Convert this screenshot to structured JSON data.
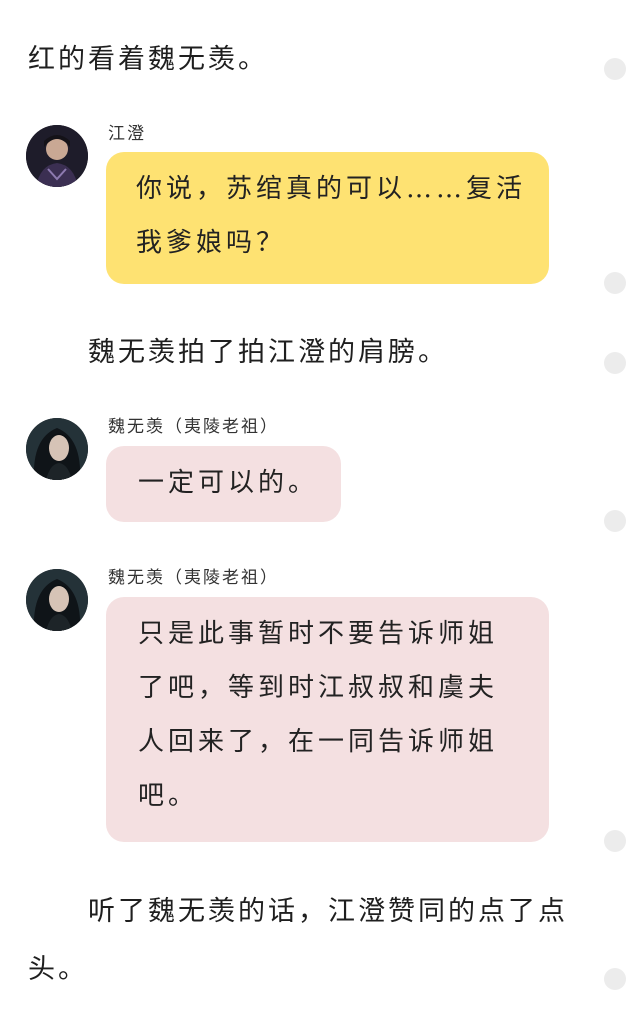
{
  "narration": {
    "line1": "红的看着魏无羡。",
    "line2": "魏无羡拍了拍江澄的肩膀。",
    "line3a": "听了魏无羡的话，江澄赞同的点了点",
    "line3b": "头。"
  },
  "messages": [
    {
      "sender": "江澄",
      "avatar_icon": "jiang-cheng-avatar",
      "bubble_color": "#fee272",
      "lines": [
        "你说，苏绾真的可以……复活",
        "我爹娘吗？"
      ]
    },
    {
      "sender": "魏无羡（夷陵老祖）",
      "avatar_icon": "wei-wuxian-avatar",
      "bubble_color": "#f4e0e1",
      "lines": [
        "一定可以的。"
      ]
    },
    {
      "sender": "魏无羡（夷陵老祖）",
      "avatar_icon": "wei-wuxian-avatar",
      "bubble_color": "#f4e0e1",
      "lines": [
        "只是此事暂时不要告诉师姐",
        "了吧，等到时江叔叔和虞夫",
        "人回来了，在一同告诉师姐",
        "吧。"
      ]
    }
  ],
  "colors": {
    "yellow_bubble": "#fee272",
    "pink_bubble": "#f4e0e1",
    "scroll_dot": "#ececec"
  }
}
